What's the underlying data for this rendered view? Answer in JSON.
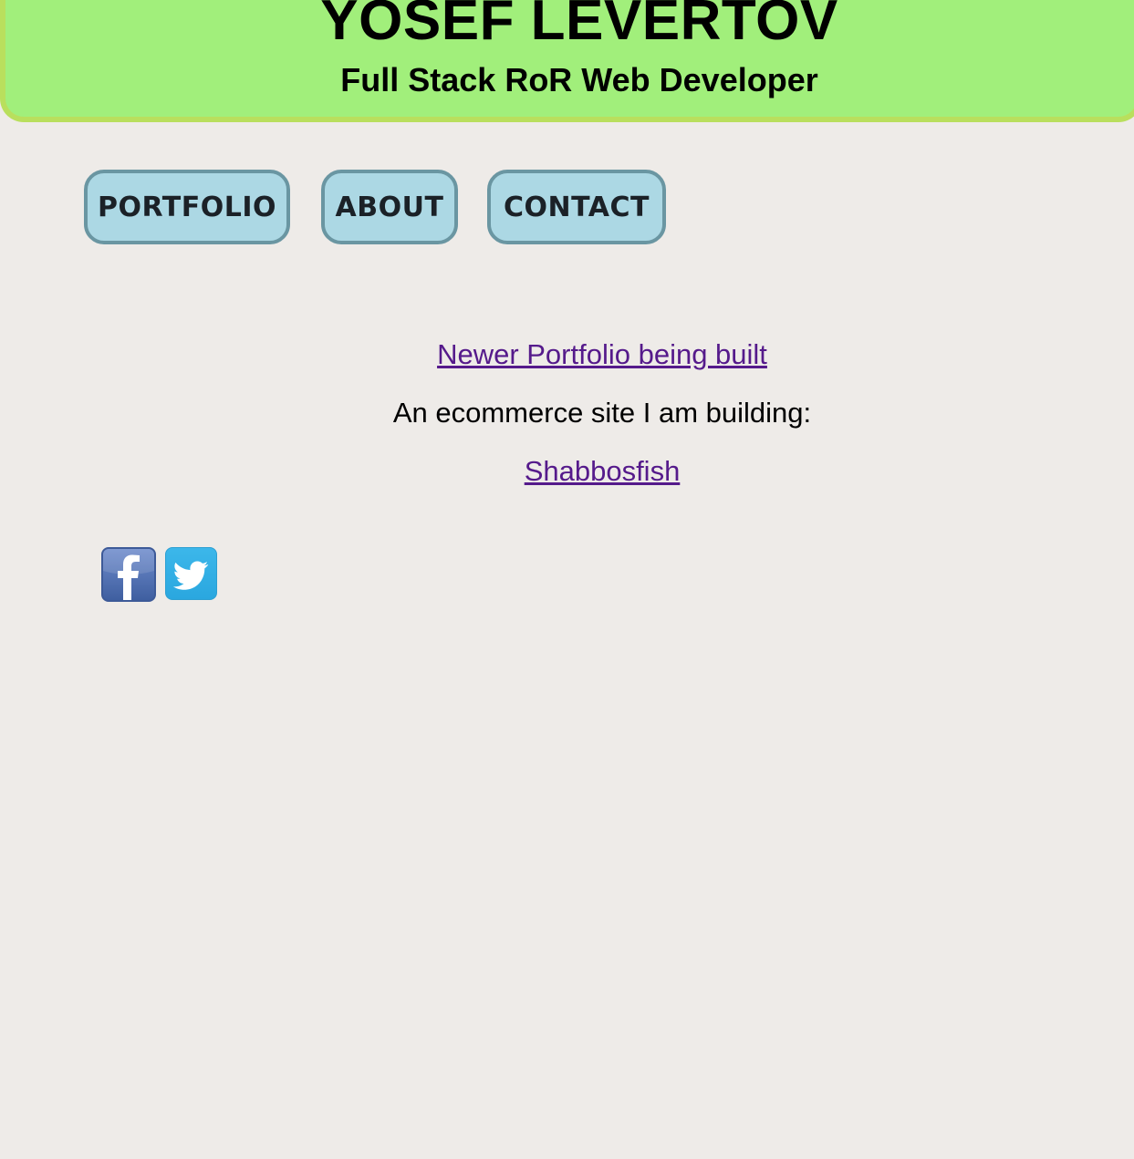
{
  "header": {
    "title": "YOSEF LEVERTOV",
    "subtitle": "Full Stack RoR Web Developer"
  },
  "nav": {
    "portfolio": "PORTFOLIO",
    "about": "ABOUT",
    "contact": "CONTACT"
  },
  "content": {
    "portfolio_link": "Newer Portfolio being built",
    "ecommerce_text": "An ecommerce site I am building:",
    "shop_link": "Shabbosfish"
  },
  "social": {
    "items": [
      {
        "icon": "facebook-icon"
      },
      {
        "icon": "twitter-icon"
      }
    ]
  },
  "colors": {
    "page_background": "#eeebe8",
    "header_background": "#a1ef7b",
    "header_border": "#b9df5d",
    "nav_background": "#acd8e4",
    "nav_border": "#6a96a2",
    "link_color": "#551a8b",
    "facebook_blue": "#3d5a98",
    "twitter_blue": "#2aa7df"
  }
}
